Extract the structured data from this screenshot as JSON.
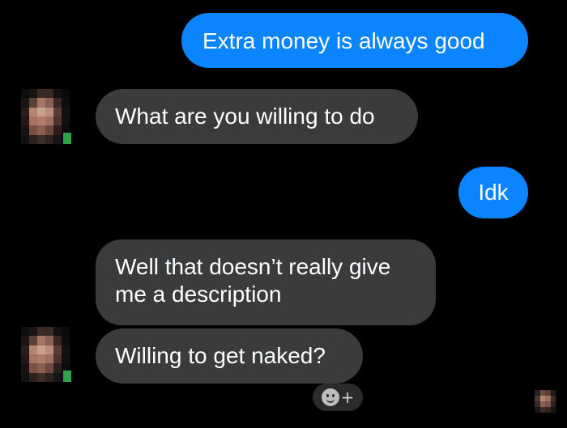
{
  "messages": [
    {
      "from": "me",
      "text": "Extra money is always good"
    },
    {
      "from": "other",
      "text": "What are you willing to do"
    },
    {
      "from": "me",
      "text": "Idk"
    },
    {
      "from": "other",
      "text": "Well that doesn’t really give me a description"
    },
    {
      "from": "other",
      "text": "Willing to get naked?"
    }
  ],
  "icons": {
    "reaction": "smiley-plus-icon",
    "online": "online-status-dot"
  },
  "colors": {
    "sent_bubble": "#0a84ff",
    "received_bubble": "#3a3b3c",
    "background": "#000000",
    "online": "#31a24c"
  }
}
